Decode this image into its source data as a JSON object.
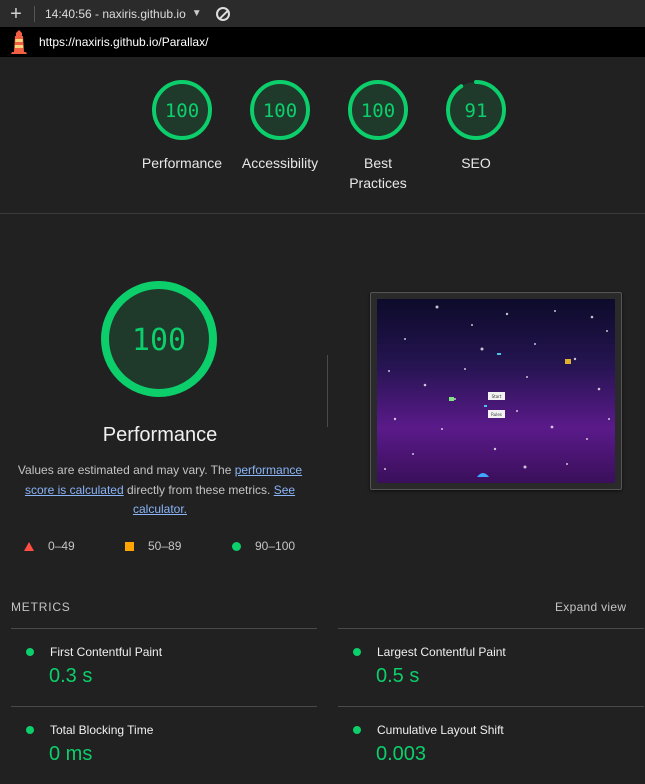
{
  "browser": {
    "tab_title": "14:40:56 - naxiris.github.io",
    "url": "https://naxiris.github.io/Parallax/"
  },
  "categories": [
    {
      "label": "Performance",
      "score": 100
    },
    {
      "label": "Accessibility",
      "score": 100
    },
    {
      "label": "Best Practices",
      "score": 100
    },
    {
      "label": "SEO",
      "score": 91
    }
  ],
  "performance": {
    "score": 100,
    "title": "Performance",
    "desc_prefix": "Values are estimated and may vary. The ",
    "link1": "performance score is calculated",
    "desc_mid": " directly from these metrics. ",
    "link2": "See calculator."
  },
  "legend": {
    "fail": "0–49",
    "average": "50–89",
    "pass": "90–100"
  },
  "screenshot": {
    "button_start": "Start",
    "button_rules": "Rules"
  },
  "metrics": {
    "heading": "METRICS",
    "expand": "Expand view",
    "items": [
      {
        "label": "First Contentful Paint",
        "value": "0.3 s"
      },
      {
        "label": "Largest Contentful Paint",
        "value": "0.5 s"
      },
      {
        "label": "Total Blocking Time",
        "value": "0 ms"
      },
      {
        "label": "Cumulative Layout Shift",
        "value": "0.003"
      }
    ]
  },
  "colors": {
    "pass": "#0cce6b",
    "average": "#ffa400",
    "fail": "#ff4e42",
    "background": "#212121"
  }
}
